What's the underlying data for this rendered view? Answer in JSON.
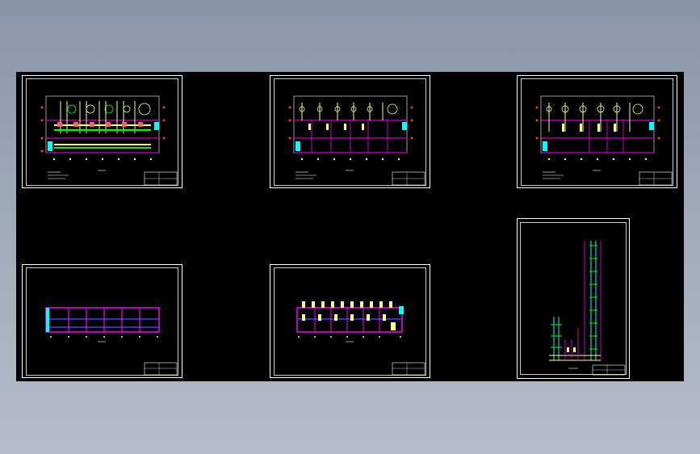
{
  "viewer": {
    "background_top": "#8795a8",
    "background_bottom": "#b4bcc8",
    "canvas_color": "#000000"
  },
  "drawing_sheets": [
    {
      "id": "sheet-1",
      "kind": "floor-plan-piping"
    },
    {
      "id": "sheet-2",
      "kind": "floor-plan-piping"
    },
    {
      "id": "sheet-3",
      "kind": "floor-plan-piping"
    },
    {
      "id": "sheet-4",
      "kind": "elevation-frame"
    },
    {
      "id": "sheet-5",
      "kind": "elevation-piping"
    },
    {
      "id": "sheet-6",
      "kind": "riser-diagram"
    }
  ],
  "colors": {
    "sheet_border": "#ffffff",
    "pipe_magenta": "#ff00ff",
    "pipe_blue": "#4040ff",
    "pipe_green": "#00ff00",
    "pipe_cyan": "#00ffff",
    "pipe_yellow": "#ffff80",
    "annotation_red": "#ff3030"
  }
}
